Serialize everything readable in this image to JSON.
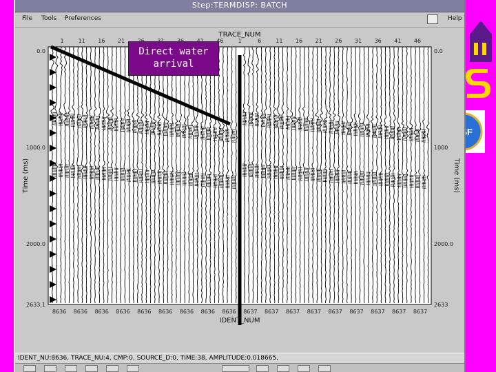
{
  "window": {
    "title": "Step:TERMDISP: BATCH"
  },
  "menubar": {
    "items": [
      "File",
      "Tools",
      "Preferences"
    ],
    "help_label": "Help"
  },
  "plot": {
    "top_axis_title": "TRACE_NUM",
    "bottom_axis_title": "IDENT_NUM",
    "left_axis_title": "Time (ms)",
    "right_axis_title": "Time (ms)",
    "top_ticks": [
      "1",
      "11",
      "16",
      "21",
      "26",
      "31",
      "36",
      "41",
      "46",
      "1",
      "6",
      "11",
      "16",
      "21",
      "26",
      "31",
      "36",
      "41",
      "46"
    ],
    "bottom_ticks": [
      "8636",
      "8636",
      "8636",
      "8636",
      "8636",
      "8636",
      "8636",
      "8636",
      "8636",
      "8637",
      "8637",
      "8637",
      "8637",
      "8637",
      "8637",
      "8637",
      "8637",
      "8637"
    ],
    "left_ticks": [
      "0.0",
      "1000.0",
      "2000.0",
      "2633.1"
    ],
    "right_ticks": [
      "0.0",
      "1000",
      "2000.0",
      "2633"
    ],
    "ink_color": "#000000",
    "background_color": "#ffffff"
  },
  "annotation": {
    "line1": "Direct water",
    "line2": "arrival",
    "fill_color": "#7b0a8a"
  },
  "statusbar": {
    "text": "IDENT_NU:8636,  TRACE_NU:4,  CMP:0,  SOURCE_D:0,  TIME:38,  AMPLITUDE:0.018665,"
  },
  "decor": {
    "lsu_logo": "lsu-logo",
    "nsf_logo": "nsf-logo",
    "nsf_label": "NSF"
  }
}
